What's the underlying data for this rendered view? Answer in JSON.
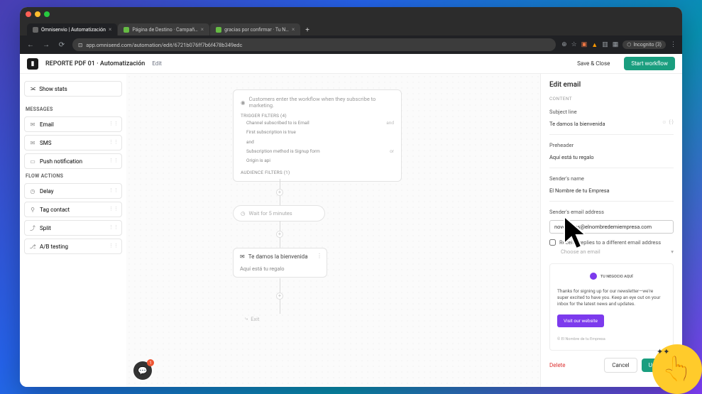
{
  "browser": {
    "tabs": [
      {
        "title": "Omnisenvio | Automatización"
      },
      {
        "title": "Página de Destino · Campañ…"
      },
      {
        "title": "gracias por confirmar · Tu N…"
      }
    ],
    "url": "app.omnisend.com/automation/edit/6721b076ff7b6f478b349edc",
    "incognito": "Incognito (3)"
  },
  "header": {
    "title": "REPORTE PDF 01 · Automatización",
    "edit": "Edit",
    "save_close": "Save & Close",
    "start": "Start workflow"
  },
  "sidebar": {
    "show_stats": "Show stats",
    "messages_title": "MESSAGES",
    "messages": [
      {
        "icon": "✉",
        "label": "Email"
      },
      {
        "icon": "✉",
        "label": "SMS"
      },
      {
        "icon": "▭",
        "label": "Push notification"
      }
    ],
    "flow_title": "FLOW ACTIONS",
    "flow": [
      {
        "icon": "◷",
        "label": "Delay"
      },
      {
        "icon": "⚲",
        "label": "Tag contact"
      },
      {
        "icon": "⤴",
        "label": "Split"
      },
      {
        "icon": "⎇",
        "label": "A/B testing"
      }
    ]
  },
  "canvas": {
    "trigger_text": "Customers enter the workflow when they subscribe to marketing.",
    "trigger_filters_title": "TRIGGER FILTERS (4)",
    "filter_lines": [
      {
        "left": "Channel subscribed to  is  Email",
        "right": "and"
      },
      {
        "left": "First subscription  is  true",
        "right": ""
      },
      {
        "left": "and",
        "right": ""
      },
      {
        "left": "Subscription method  is  Signup form",
        "right": "or"
      },
      {
        "left": "Origin  is  api",
        "right": ""
      }
    ],
    "audience_title": "AUDIENCE FILTERS (1)",
    "wait_label": "Wait for 5 minutes",
    "email_title": "Te damos la bienvenida",
    "email_sub": "Aquí está tu regalo",
    "exit": "Exit"
  },
  "panel": {
    "title": "Edit email",
    "content_lbl": "CONTENT",
    "subject_lbl": "Subject line",
    "subject_val": "Te damos la bienvenida",
    "preheader_lbl": "Preheader",
    "preheader_val": "Aquí está tu regalo",
    "sender_name_lbl": "Sender's name",
    "sender_name_val": "El Nombre de tu Empresa",
    "sender_email_lbl": "Sender's email address",
    "sender_email_val": "novedades@elnombredemiempresa.com",
    "reply_checkbox": "Receive replies to a different email address",
    "choose_email": "Choose an email",
    "preview": {
      "logo_text": "TU NEGOCIO AQUÍ",
      "body": "Thanks for signing up for our newsletter—we're super excited to have you. Keep an eye out on your inbox for the latest news and updates.",
      "cta": "Visit our website",
      "footer": "© El Nombre de tu Empresa"
    },
    "delete": "Delete",
    "cancel": "Cancel",
    "update": "Update"
  },
  "chat_badge": "1"
}
